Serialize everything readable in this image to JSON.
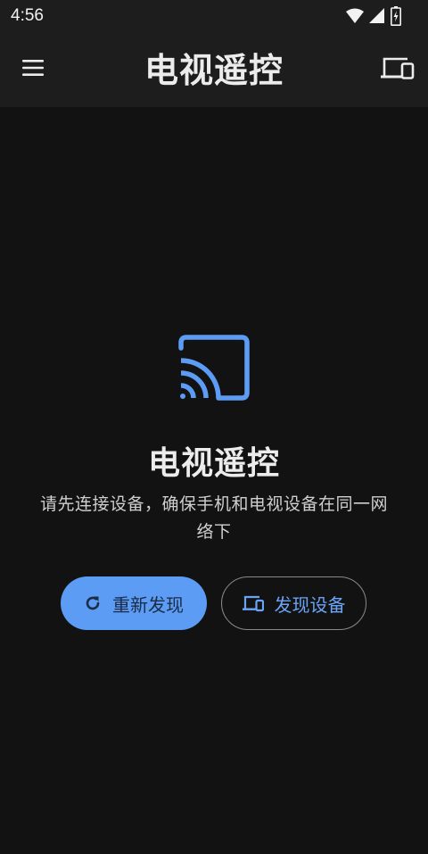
{
  "status_bar": {
    "time": "4:56",
    "icons": [
      "wifi-icon",
      "signal-icon",
      "battery-charging-icon"
    ]
  },
  "app_bar": {
    "title": "电视遥控",
    "menu_icon": "menu-icon",
    "action_icon": "devices-icon"
  },
  "empty_state": {
    "icon": "cast-icon",
    "title": "电视遥控",
    "description": "请先连接设备，确保手机和电视设备在同一网络下"
  },
  "buttons": {
    "refresh_label": "重新发现",
    "refresh_icon": "refresh-icon",
    "discover_label": "发现设备",
    "discover_icon": "devices-icon"
  },
  "colors": {
    "background": "#121212",
    "app_bar": "#1d1d1d",
    "accent": "#5c9cf5",
    "text": "#ececec"
  }
}
